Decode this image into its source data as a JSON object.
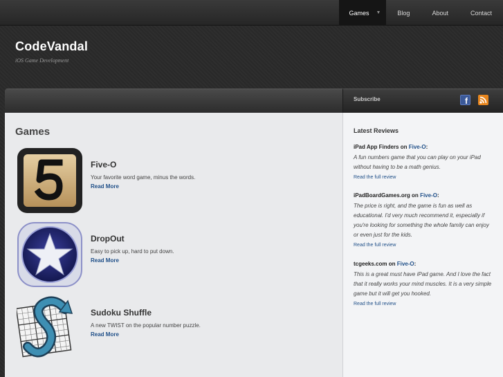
{
  "nav": {
    "items": [
      {
        "label": "Games",
        "active": true
      },
      {
        "label": "Blog",
        "active": false
      },
      {
        "label": "About",
        "active": false
      },
      {
        "label": "Contact",
        "active": false
      }
    ]
  },
  "brand": {
    "title": "CodeVandal",
    "tagline": "iOS Game Development"
  },
  "subscribe": {
    "label": "Subscribe",
    "icons": [
      "facebook-icon",
      "rss-icon"
    ]
  },
  "main": {
    "heading": "Games",
    "games": [
      {
        "title": "Five-O",
        "description": "Your favorite word game, minus the words.",
        "link": "Read More",
        "icon": "five-o-app-icon"
      },
      {
        "title": "DropOut",
        "description": "Easy to pick up, hard to put down.",
        "link": "Read More",
        "icon": "dropout-app-icon"
      },
      {
        "title": "Sudoku Shuffle",
        "description": "A new TWIST on the popular number puzzle.",
        "link": "Read More",
        "icon": "sudoku-shuffle-app-icon"
      }
    ]
  },
  "sidebar": {
    "heading": "Latest Reviews",
    "reviews": [
      {
        "source": "iPad App Finders",
        "on": "on",
        "game": "Five-O",
        "suffix": ":",
        "quote": "A fun numbers game that you can play on your iPad without having to be a math genius.",
        "link": "Read the full review"
      },
      {
        "source": "iPadBoardGames.org",
        "on": "on",
        "game": "Five-O",
        "suffix": ":",
        "quote": "The price is right, and the game is fun as well as educational. I'd very much recommend it, especially if you're looking for something the whole family can enjoy or even just for the kids.",
        "link": "Read the full review"
      },
      {
        "source": "tcgeeks.com",
        "on": "on",
        "game": "Five-O",
        "suffix": ":",
        "quote": "This is a great must have iPad game. And I love the fact that it really works your mind muscles. It is a very simple game but it will get you hooked.",
        "link": "Read the full review"
      }
    ]
  },
  "colors": {
    "link": "#1f4f88",
    "facebook": "#3b5998",
    "rss": "#e8861e"
  }
}
